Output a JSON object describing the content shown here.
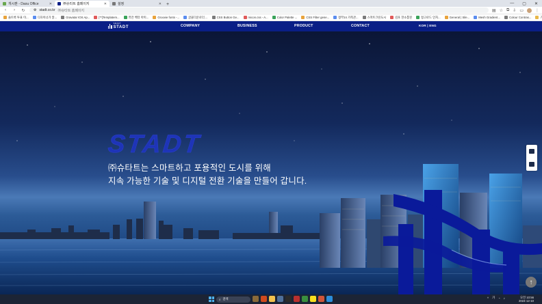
{
  "browser": {
    "tabs": [
      {
        "label": "개시판 - Daou Office",
        "active": false,
        "favicon_color": "#6aa84f"
      },
      {
        "label": "㈜슈타트 홈페이지",
        "active": true,
        "favicon_color": "#0a1f86"
      },
      {
        "label": "설정",
        "active": false,
        "favicon_color": "#777777"
      }
    ],
    "new_tab_symbol": "+",
    "window_controls": [
      "—",
      "▢",
      "✕"
    ],
    "nav": {
      "back": "‹",
      "forward": "›",
      "reload": "↻"
    },
    "address": {
      "url": "stadt.co.kr",
      "title": "㈜슈타트 홈페이지"
    },
    "bookmarks": [
      "솔트룩 투표 이...",
      "디자이너가 알...",
      "Gravatar IOS Ap...",
      "[**]Templatem...",
      "퓨전 벡터 아이...",
      "Groovie fonts -...",
      "글꼴다운로더 ...",
      "CSS Button Ge...",
      "micon.css - A...",
      "Color Palette ...",
      "CSS Filter gene...",
      "정부24 가족관...",
      "스마트크린도시",
      "김포 한소통된",
      "정고로드 인차...",
      "General | Sile...",
      "Mesh Gradient...",
      "Colour Contras..."
    ],
    "bookmarks_right": [
      "기타 북마크",
      "모바일 북마크"
    ]
  },
  "site": {
    "logo_small": "SMART",
    "logo_big": "STADT",
    "menu": [
      "COMPANY",
      "BUSINESS",
      "PRODUCT",
      "CONTACT"
    ],
    "lang": "KOR | ENG",
    "hero": {
      "headline": "STADT",
      "line1": "㈜슈타트는 스마트하고 포용적인 도시를 위해",
      "line2": "지속 가능한 기술 및 디지털 전환 기술을 만들어 갑니다."
    },
    "scroll_top_symbol": "↑"
  },
  "taskbar": {
    "search_placeholder": "검색",
    "clock_time": "오전 10:56",
    "clock_date": "2024-12-10",
    "ime": "가",
    "colors": {
      "accent": "#0a1f86",
      "headline": "#1e34b8"
    }
  }
}
